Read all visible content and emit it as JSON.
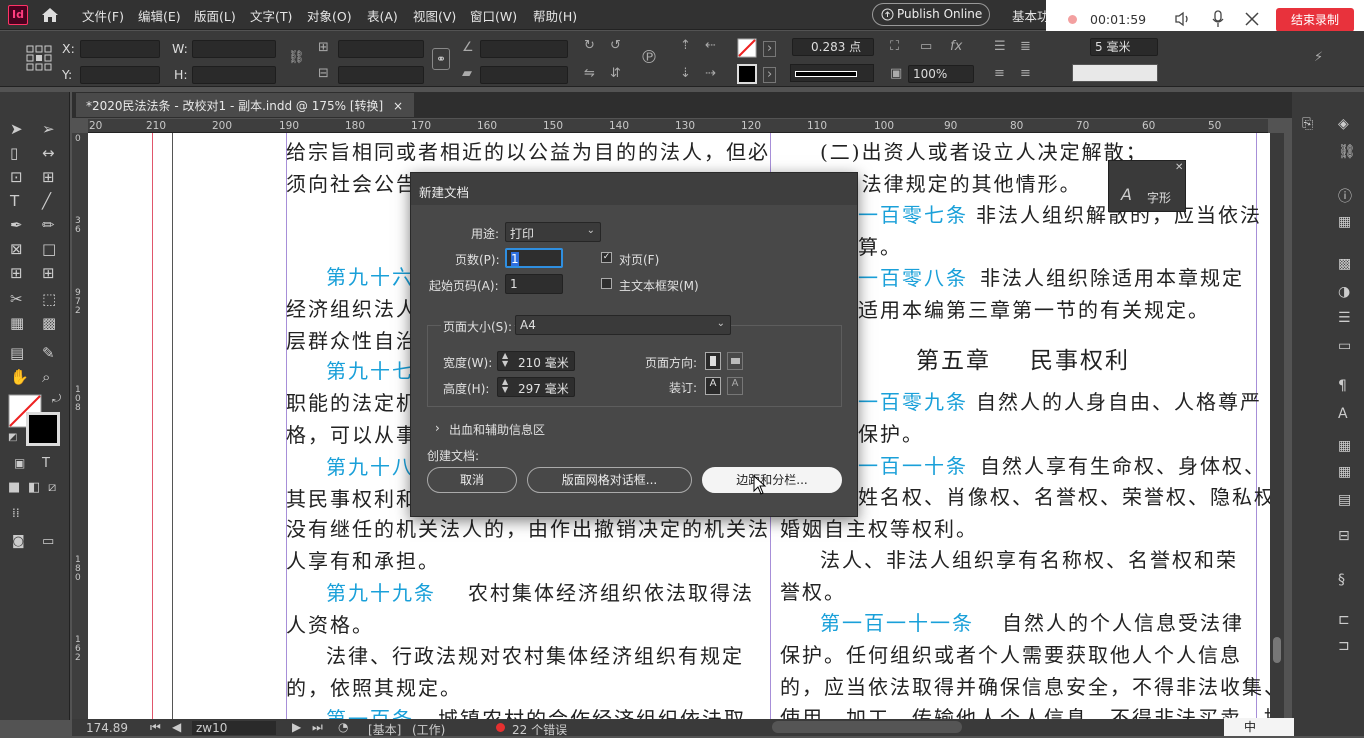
{
  "app": {
    "logo": "Id",
    "home_icon": "home-icon"
  },
  "menu": [
    "文件(F)",
    "编辑(E)",
    "版面(L)",
    "文字(T)",
    "对象(O)",
    "表(A)",
    "视图(V)",
    "窗口(W)",
    "帮助(H)"
  ],
  "publish_online": "Publish Online",
  "workspace": "基本功",
  "recorder": {
    "time": "00:01:59",
    "end_label": "结束录制"
  },
  "control": {
    "x_label": "X:",
    "y_label": "Y:",
    "w_label": "W:",
    "h_label": "H:",
    "stroke_weight": "0.283 点",
    "zoom_pct": "100%",
    "gutter": "5 毫米"
  },
  "doc_tab": {
    "title": "*2020民法法条 - 改校对1 - 副本.indd @ 175% [转换]",
    "close": "×"
  },
  "ruler_h": [
    "20",
    "210",
    "200",
    "190",
    "180",
    "170",
    "160",
    "150",
    "140",
    "130",
    "120",
    "110",
    "100",
    "90",
    "80",
    "70",
    "60",
    "50"
  ],
  "ruler_v": [
    "0",
    "3",
    "6",
    "9",
    "7",
    "2",
    "1",
    "0",
    "8",
    "1",
    "8",
    "0",
    "1",
    "6",
    "2"
  ],
  "page_text": {
    "l1": "给宗旨相同或者相近的以公益为目的的法人，但必",
    "l2": "须向社会公告",
    "l3a": "第九十六",
    "l4": "经济组织法人",
    "l5": "层群众性自治",
    "l6a": "第九十七",
    "l7": "职能的法定机",
    "l8": "格，可以从事",
    "l9a": "第九十八",
    "l10": "其民事权利和",
    "l11": "没有继任的机关法人的，由作出撤销决定的机关法",
    "l12": "人享有和承担。",
    "l13a": "第九十九条",
    "l13b": "农村集体经济组织依法取得法",
    "l14": "人资格。",
    "l15": "法律、行政法规对农村集体经济组织有规定",
    "l16": "的，依照其规定。",
    "l17a": "第一百条",
    "l17b": "城镇农村的合作经济组织依法取",
    "r1": "(二)出资人或者设立人决定解散；",
    "r2": "(三)法律规定的其他情形。",
    "r3a": "一百零七条",
    "r3b": "非法人组织解散的，应当依法",
    "r4": "算。",
    "r5a": "一百零八条",
    "r5b": "非法人组织除适用本章规定",
    "r6": "适用本编第三章第一节的有关规定。",
    "r7a": "第五章",
    "r7b": "民事权利",
    "r8a": "一百零九条",
    "r8b": "自然人的人身自由、人格尊严",
    "r9": "保护。",
    "r10a": "一百一十条",
    "r10b": "自然人享有生命权、身体权、",
    "r11": "姓名权、肖像权、名誉权、荣誉权、隐私权、",
    "r12": "婚姻自主权等权利。",
    "r13": "法人、非法人组织享有名称权、名誉权和荣",
    "r14": "誉权。",
    "r15a": "第一百一十一条",
    "r15b": "自然人的个人信息受法律",
    "r16": "保护。任何组织或者个人需要获取他人个人信息",
    "r17": "的，应当依法取得并确保信息安全，不得非法收集、",
    "r18": "使用、加工、传输他人个人信息，不得非法买卖、提",
    "pilcrow": "¶"
  },
  "glyph_panel": {
    "label": "字形"
  },
  "dialog": {
    "title": "新建文档",
    "intent_label": "用途:",
    "intent_value": "打印",
    "pages_label": "页数(P):",
    "pages_value": "1",
    "facing_label": "对页(F)",
    "facing_checked": true,
    "start_label": "起始页码(A):",
    "start_value": "1",
    "primary_frame_label": "主文本框架(M)",
    "primary_frame_checked": false,
    "size_label": "页面大小(S):",
    "size_value": "A4",
    "width_label": "宽度(W):",
    "width_value": "210 毫米",
    "height_label": "高度(H):",
    "height_value": "297 毫米",
    "orient_label": "页面方向:",
    "binding_label": "装订:",
    "bleed_label": "出血和辅助信息区",
    "create_label": "创建文档:",
    "cancel": "取消",
    "layout_grid": "版面网格对话框...",
    "margins": "边距和分栏..."
  },
  "status": {
    "zoom": "174.89",
    "page": "zw10",
    "base": "[基本]",
    "work": "(工作)",
    "errors": "22 个错误",
    "ime": "中"
  }
}
